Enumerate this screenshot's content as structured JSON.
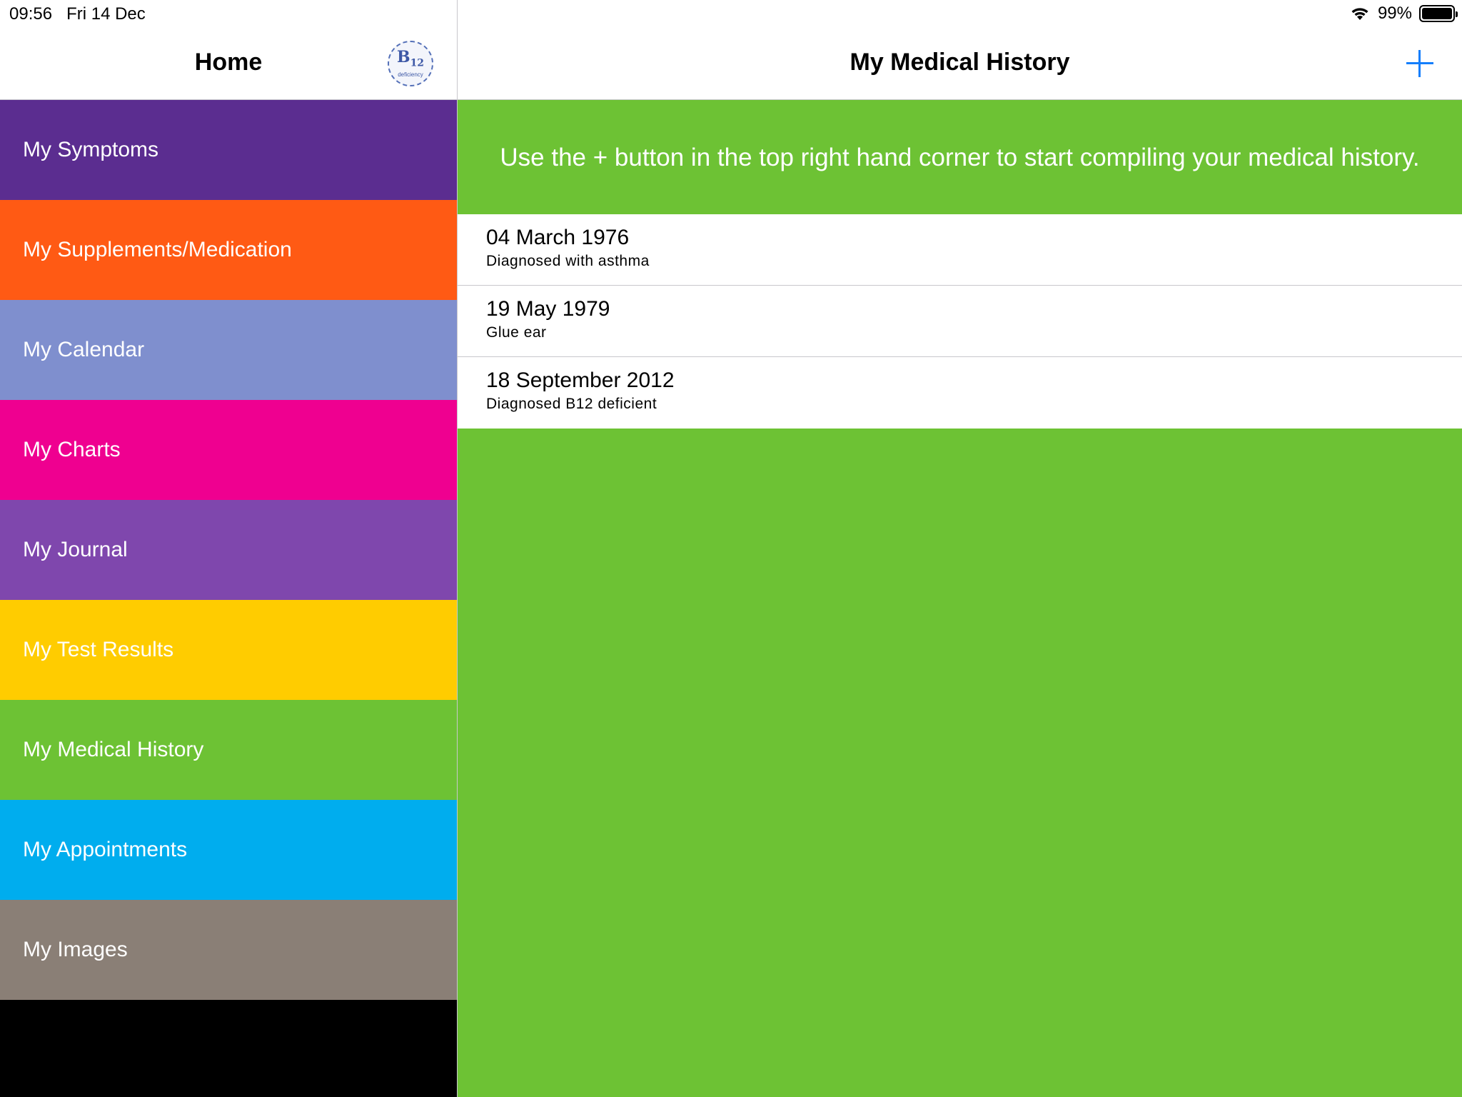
{
  "status_bar": {
    "time": "09:56",
    "date": "Fri 14 Dec",
    "battery_percent": "99%",
    "battery_level": 0.99
  },
  "master": {
    "title": "Home",
    "logo": {
      "mark": "B",
      "subscript": "12",
      "sub_text": "deficiency"
    },
    "menu": [
      {
        "label": "My Symptoms",
        "color": "#5b2d90"
      },
      {
        "label": "My Supplements/Medication",
        "color": "#ff5a14"
      },
      {
        "label": "My Calendar",
        "color": "#7f8fce"
      },
      {
        "label": "My Charts",
        "color": "#ef0090"
      },
      {
        "label": "My Journal",
        "color": "#7f47ad"
      },
      {
        "label": "My Test Results",
        "color": "#ffcc00"
      },
      {
        "label": "My Medical History",
        "color": "#6dc234"
      },
      {
        "label": "My Appointments",
        "color": "#00adee"
      },
      {
        "label": "My Images",
        "color": "#8a7f76"
      }
    ]
  },
  "detail": {
    "title": "My Medical History",
    "add_icon": "plus-icon",
    "accent_color": "#147efb",
    "background_color": "#6dc234",
    "hint": "Use the + button in the top right hand corner to start compiling your medical history.",
    "entries": [
      {
        "date": "04 March 1976",
        "description": "Diagnosed with asthma"
      },
      {
        "date": "19 May 1979",
        "description": "Glue ear"
      },
      {
        "date": "18 September 2012",
        "description": "Diagnosed B12 deficient"
      }
    ]
  }
}
